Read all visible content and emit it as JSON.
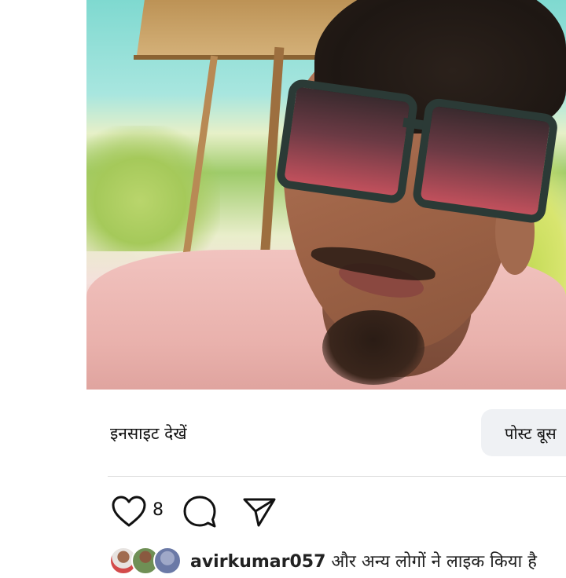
{
  "post": {
    "image_alt": "photo of a young man wearing dark sunglasses and a pink t-shirt",
    "insights_label": "इनसाइट देखें",
    "boost_label": "पोस्ट बूस",
    "like_count": "8",
    "liked_by_user": "avirkumar057",
    "liked_by_suffix": " और अन्य लोगों ने लाइक किया है"
  },
  "icons": {
    "like": "heart-icon",
    "comment": "comment-icon",
    "share": "send-icon"
  }
}
